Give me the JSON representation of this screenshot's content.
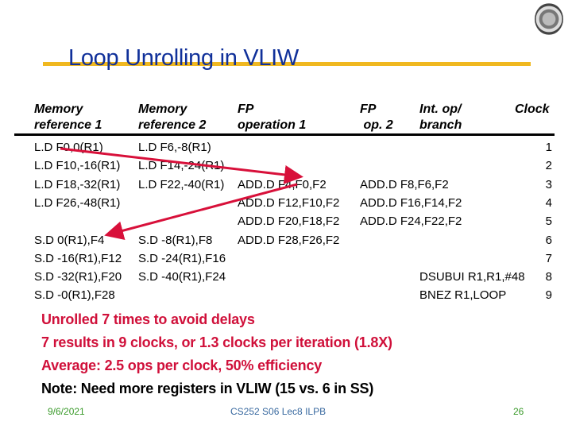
{
  "slide": {
    "title": "Loop Unrolling in VLIW",
    "logo": "university-seal-icon"
  },
  "table": {
    "headers": [
      {
        "line1": "Memory",
        "line2": "reference 1"
      },
      {
        "line1": "Memory",
        "line2": "reference 2"
      },
      {
        "line1": "FP",
        "line2": "operation 1"
      },
      {
        "line1": "FP",
        "line2": " op. 2"
      },
      {
        "line1": "Int. op/",
        "line2": "branch"
      },
      {
        "line1": "Clock",
        "line2": ""
      }
    ],
    "rows": [
      {
        "mem1": "L.D F0,0(R1)",
        "mem2": "L.D F6,-8(R1)",
        "fp1": "",
        "fp2": "",
        "int": "",
        "clock": "1"
      },
      {
        "mem1": "L.D F10,-16(R1)",
        "mem2": "L.D F14,-24(R1)",
        "fp1": "",
        "fp2": "",
        "int": "",
        "clock": "2"
      },
      {
        "mem1": "L.D F18,-32(R1)",
        "mem2": "L.D F22,-40(R1)",
        "fp1": "ADD.D F4,F0,F2",
        "fp2": "ADD.D F8,F6,F2",
        "int": "",
        "clock": "3"
      },
      {
        "mem1": "L.D F26,-48(R1)",
        "mem2": "",
        "fp1": "ADD.D F12,F10,F2",
        "fp2": "ADD.D F16,F14,F2",
        "int": "",
        "clock": "4"
      },
      {
        "mem1": "",
        "mem2": "",
        "fp1": "ADD.D F20,F18,F2",
        "fp2": "ADD.D F24,F22,F2",
        "int": "",
        "clock": "5"
      },
      {
        "mem1": "S.D 0(R1),F4",
        "mem2": "S.D -8(R1),F8",
        "fp1": "ADD.D F28,F26,F2",
        "fp2": "",
        "int": "",
        "clock": "6"
      },
      {
        "mem1": "S.D -16(R1),F12",
        "mem2": "S.D -24(R1),F16",
        "fp1": "",
        "fp2": "",
        "int": "",
        "clock": "7"
      },
      {
        "mem1": "S.D -32(R1),F20",
        "mem2": "S.D -40(R1),F24",
        "fp1": "",
        "fp2": "",
        "int": "DSUBUI  R1,R1,#48",
        "clock": "8"
      },
      {
        "mem1": "S.D -0(R1),F28",
        "mem2": "",
        "fp1": "",
        "fp2": "",
        "int": "BNEZ R1,LOOP",
        "clock": "9"
      }
    ]
  },
  "notes": [
    {
      "text": "Unrolled 7 times to avoid delays",
      "color": "#d0103a"
    },
    {
      "text": "7 results in 9 clocks, or 1.3 clocks per iteration (1.8X)",
      "color": "#d0103a"
    },
    {
      "text": "Average: 2.5 ops per clock, 50% efficiency",
      "color": "#d0103a"
    },
    {
      "text": "Note: Need more registers in VLIW (15 vs. 6 in SS)",
      "color": "#000000"
    }
  ],
  "footer": {
    "date": "9/6/2021",
    "course": "CS252 S06 Lec8 ILPB",
    "page": "26"
  },
  "colors": {
    "title": "#10309a",
    "title_underline": "#f0b820",
    "arrow": "#d8103a",
    "footer_green": "#3a9a2a",
    "footer_blue": "#3a6aa0"
  }
}
